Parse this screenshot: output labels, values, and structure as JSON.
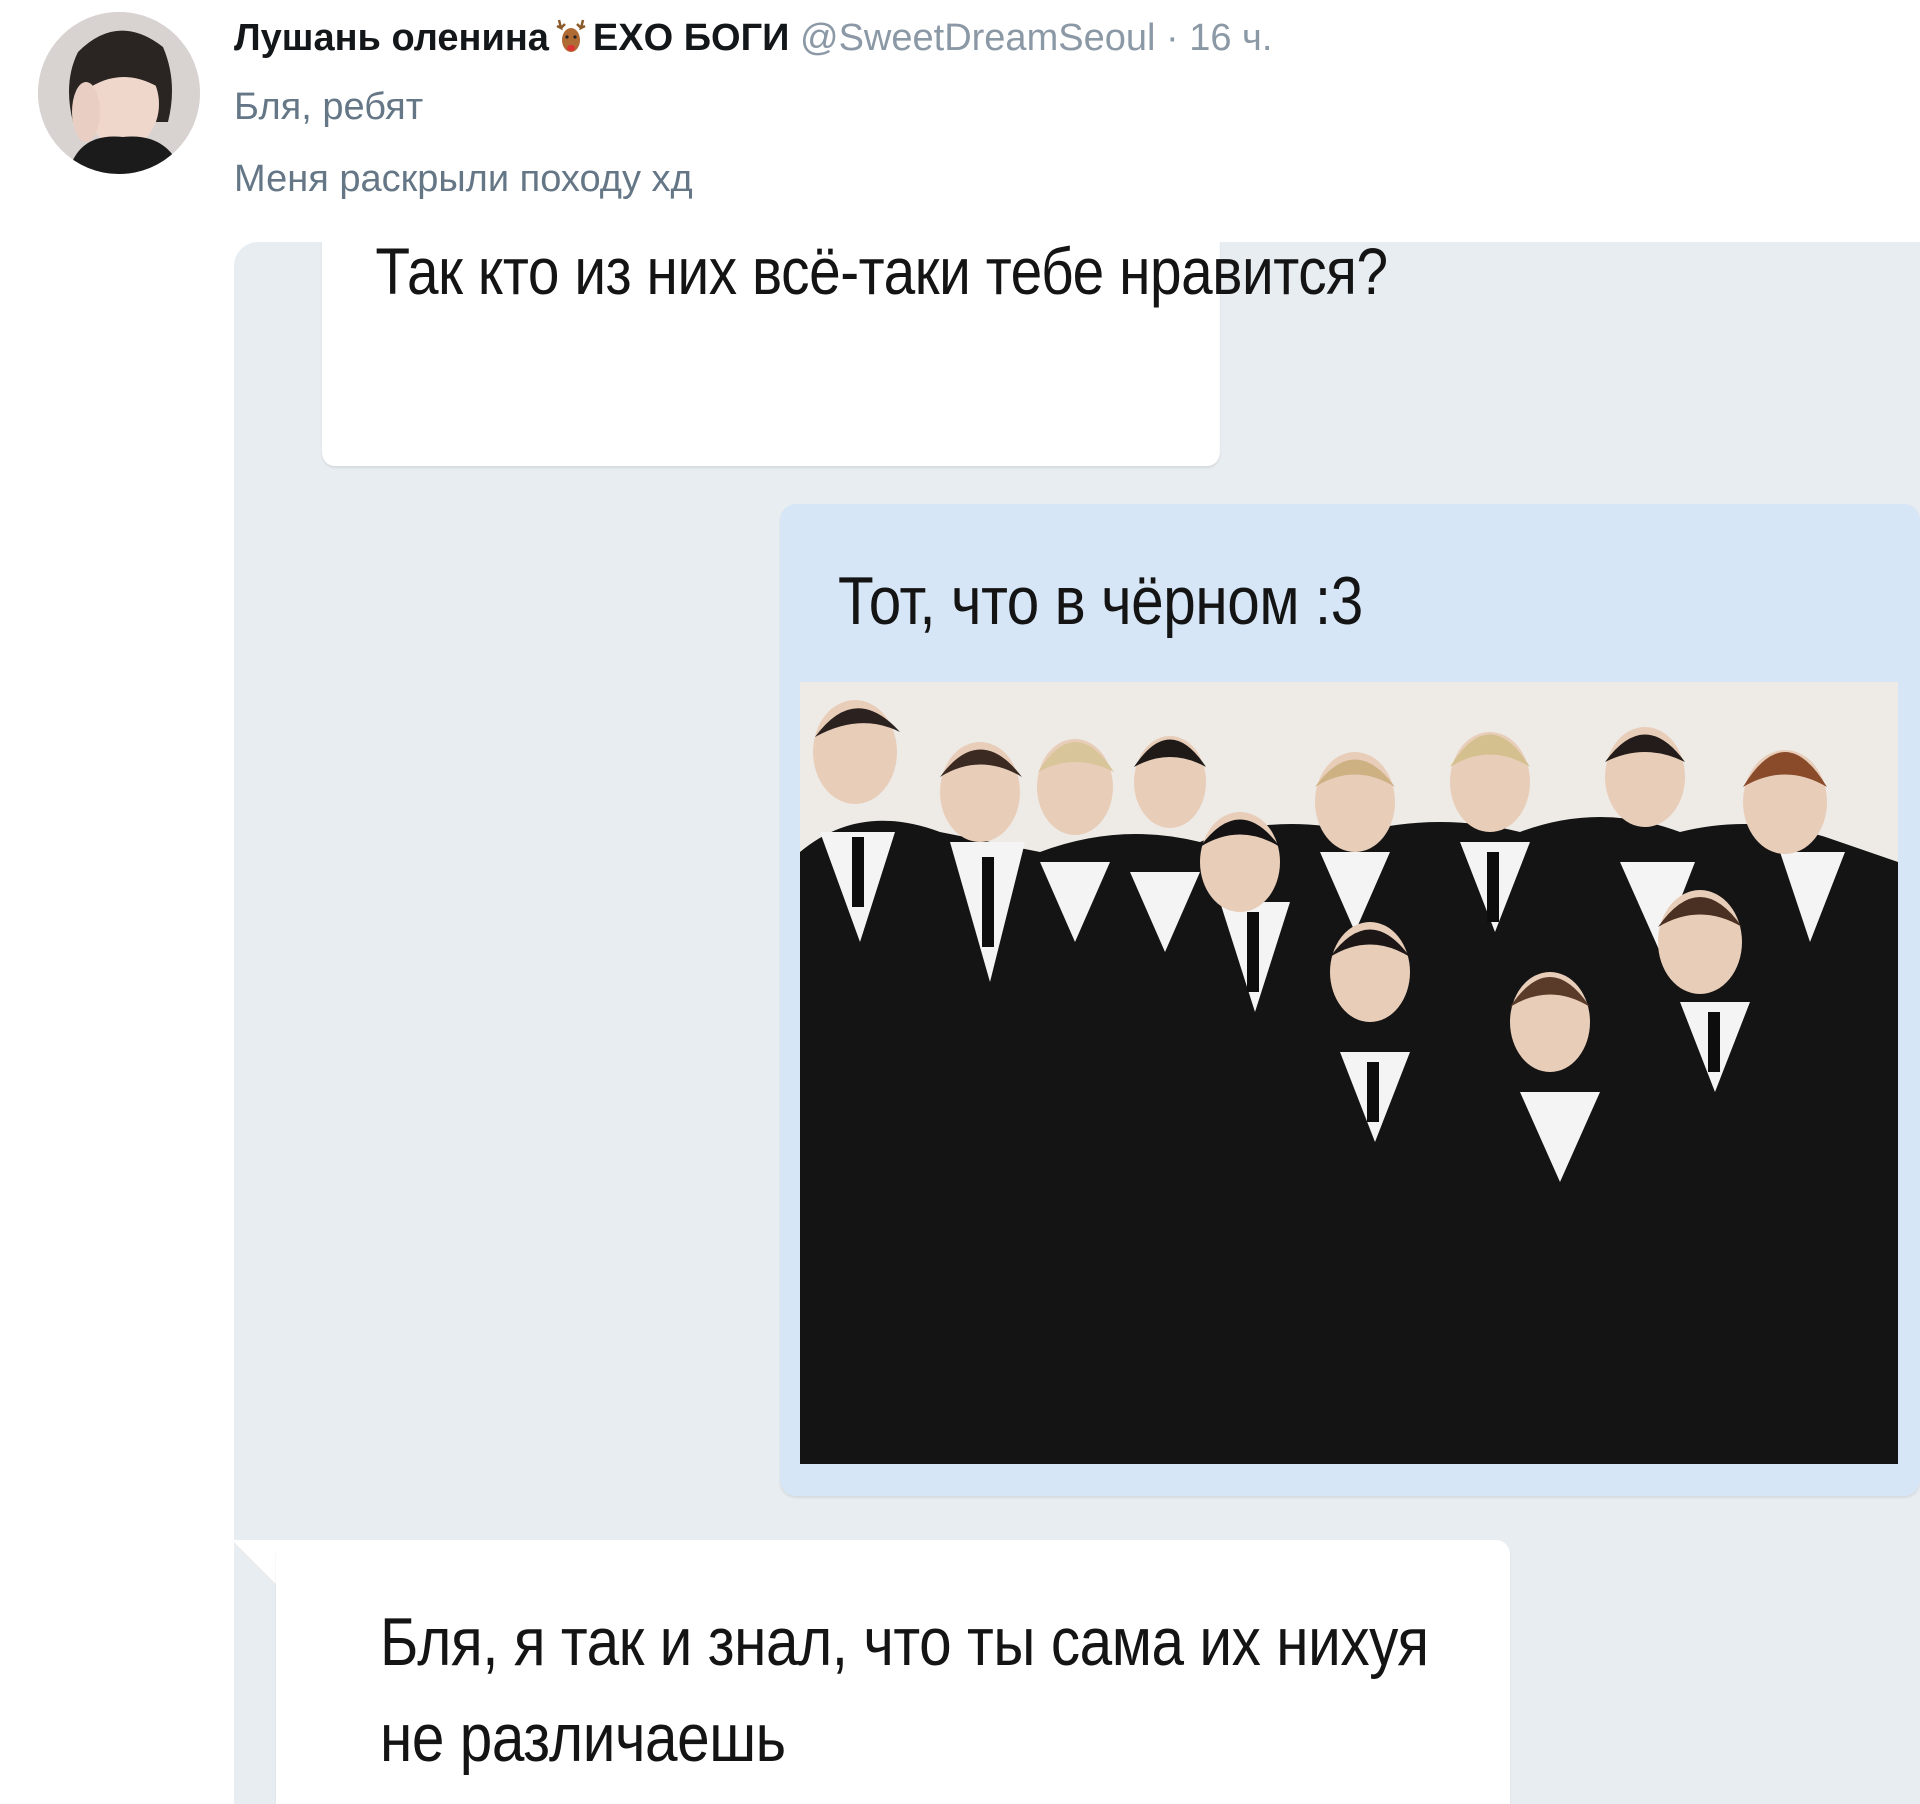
{
  "tweet": {
    "display_name": "Лушань оленина",
    "display_name_suffix": "EXO БОГИ",
    "name_emoji": "deer-emoji",
    "handle": "@SweetDreamSeoul",
    "separator": "·",
    "time": "16 ч.",
    "text_line_1": "Бля, ребят",
    "text_line_2": "Меня раскрыли походу хд"
  },
  "chat": {
    "messages": [
      {
        "side": "incoming",
        "text": "Так кто из них всё-таки тебе нравится?"
      },
      {
        "side": "outgoing",
        "text": "Тот, что в чёрном :3",
        "has_photo": true
      },
      {
        "side": "incoming",
        "text": "Бля, я так и знал, что ты сама их нихуя не различаешь"
      }
    ]
  },
  "colors": {
    "chat_background": "#e8edf1",
    "incoming_bubble": "#ffffff",
    "outgoing_bubble": "#d6e6f6",
    "muted_text": "#8b98a5"
  }
}
